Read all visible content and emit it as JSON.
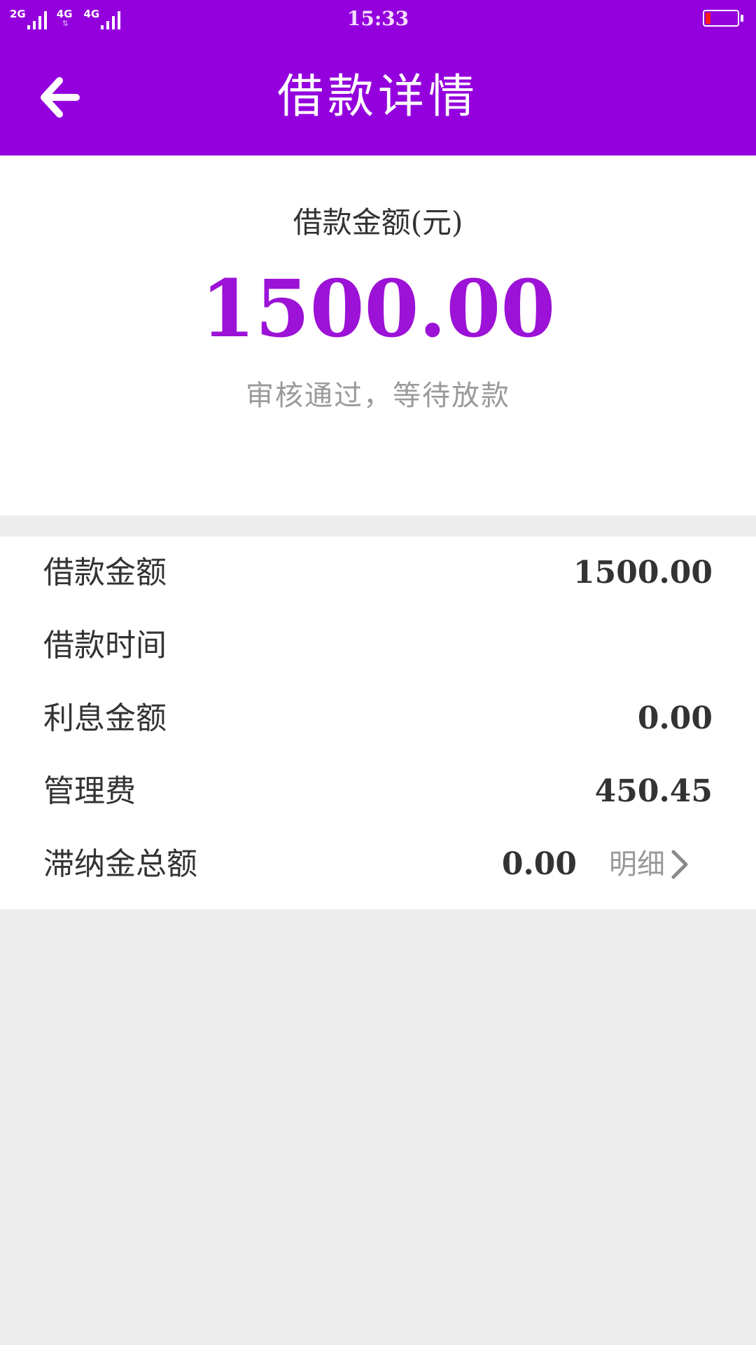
{
  "status_bar": {
    "network_1": "2G",
    "network_2": "4G",
    "network_3": "4G",
    "time": "15:33",
    "battery_level_fraction": 0.15,
    "battery_fill_color": "#ff1a1a"
  },
  "header": {
    "title": "借款详情",
    "back_icon": "arrow-left-icon",
    "background_color": "#9400dd"
  },
  "summary": {
    "label": "借款金额(元)",
    "amount": "1500.00",
    "status": "审核通过，等待放款",
    "amount_color": "#9c12d6"
  },
  "details": {
    "rows": [
      {
        "label": "借款金额",
        "value": "1500.00"
      },
      {
        "label": "借款时间",
        "value": ""
      },
      {
        "label": "利息金额",
        "value": "0.00"
      },
      {
        "label": "管理费",
        "value": "450.45"
      }
    ],
    "late_fee": {
      "label": "滞纳金总额",
      "value": "0.00",
      "link_label": "明细",
      "link_icon": "chevron-right-icon"
    }
  }
}
